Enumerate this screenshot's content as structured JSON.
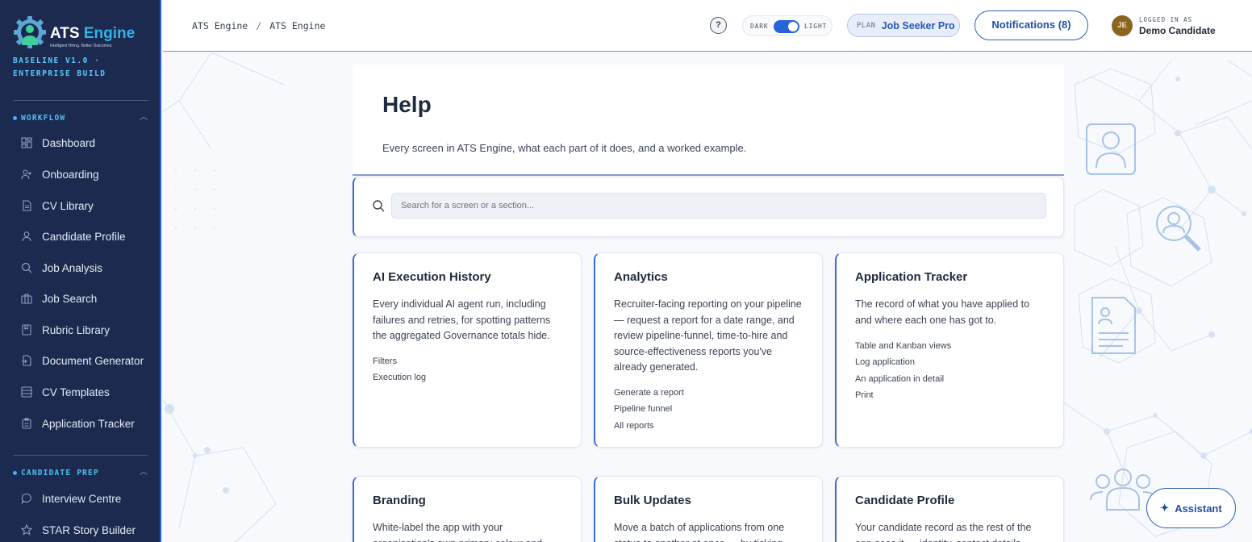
{
  "brand": {
    "name_main": "ATS",
    "name_accent": "Engine",
    "tagline": "Intelligent Hiring. Better Outcomes.",
    "build_label": "BASELINE V1.0 · ENTERPRISE BUILD",
    "colors": {
      "sidebar_bg": "#1b2a4e",
      "accent": "#2d5fd0",
      "cyan": "#4fc0f5"
    }
  },
  "sidebar": {
    "sections": [
      {
        "label": "WORKFLOW",
        "items": [
          {
            "label": "Dashboard",
            "icon": "dashboard-icon"
          },
          {
            "label": "Onboarding",
            "icon": "user-plus-icon"
          },
          {
            "label": "CV Library",
            "icon": "document-icon"
          },
          {
            "label": "Candidate Profile",
            "icon": "user-icon"
          },
          {
            "label": "Job Analysis",
            "icon": "search-icon"
          },
          {
            "label": "Job Search",
            "icon": "briefcase-icon"
          },
          {
            "label": "Rubric Library",
            "icon": "bookmark-icon"
          },
          {
            "label": "Document Generator",
            "icon": "file-export-icon"
          },
          {
            "label": "CV Templates",
            "icon": "layout-icon"
          },
          {
            "label": "Application Tracker",
            "icon": "clipboard-icon"
          }
        ]
      },
      {
        "label": "CANDIDATE PREP",
        "items": [
          {
            "label": "Interview Centre",
            "icon": "chat-icon"
          },
          {
            "label": "STAR Story Builder",
            "icon": "star-icon"
          }
        ]
      }
    ]
  },
  "header": {
    "breadcrumb": [
      "ATS Engine",
      "ATS Engine"
    ],
    "breadcrumb_sep": "/",
    "help_icon": "question-icon",
    "theme": {
      "dark_label": "DARK",
      "light_label": "LIGHT",
      "active": "light"
    },
    "plan": {
      "label": "PLAN",
      "name": "Job Seeker Pro"
    },
    "notifications_label": "Notifications (8)",
    "user": {
      "initials": "JE",
      "label": "LOGGED IN AS",
      "name": "Demo Candidate"
    }
  },
  "main": {
    "title": "Help",
    "subtitle": "Every screen in ATS Engine, what each part of it does, and a worked example.",
    "search": {
      "placeholder": "Search for a screen or a section...",
      "value": ""
    },
    "cards": [
      {
        "title": "AI Execution History",
        "description": "Every individual AI agent run, including failures and retries, for spotting patterns the aggregated Governance totals hide.",
        "sections": [
          "Filters",
          "Execution log"
        ]
      },
      {
        "title": "Analytics",
        "description": "Recruiter-facing reporting on your pipeline — request a report for a date range, and review pipeline-funnel, time-to-hire and source-effectiveness reports you've already generated.",
        "sections": [
          "Generate a report",
          "Pipeline funnel",
          "All reports"
        ]
      },
      {
        "title": "Application Tracker",
        "description": "The record of what you have applied to and where each one has got to.",
        "sections": [
          "Table and Kanban views",
          "Log application",
          "An application in detail",
          "Print"
        ]
      },
      {
        "title": "Branding",
        "description": "White-label the app with your organisation's own primary colour and",
        "sections": []
      },
      {
        "title": "Bulk Updates",
        "description": "Move a batch of applications from one status to another at once — by ticking",
        "sections": []
      },
      {
        "title": "Candidate Profile",
        "description": "Your candidate record as the rest of the app sees it — identity, contact details",
        "sections": []
      }
    ]
  },
  "assistant": {
    "label": "Assistant",
    "icon": "sparkle-icon"
  }
}
